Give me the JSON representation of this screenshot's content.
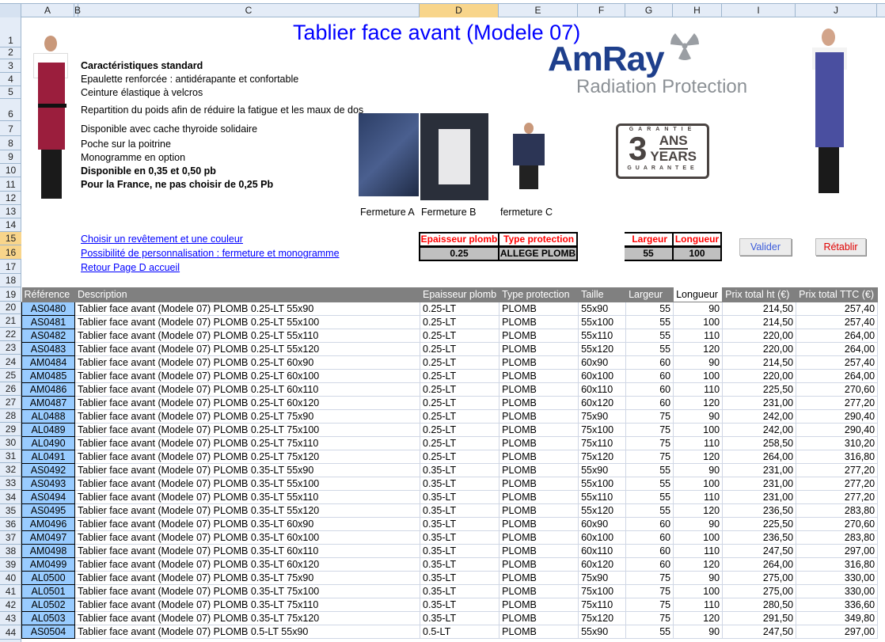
{
  "columns": [
    "A",
    "B",
    "C",
    "D",
    "E",
    "F",
    "G",
    "H",
    "I",
    "J"
  ],
  "title": "Tablier face avant (Modele 07)",
  "features": [
    {
      "text": "Caractéristiques standard",
      "bold": true
    },
    {
      "text": "Epaulette renforcée : antidérapante et confortable",
      "bold": false
    },
    {
      "text": "Ceinture élastique à velcros",
      "bold": false
    },
    {
      "text": "Repartition du poids afin de réduire la fatigue et les maux de dos",
      "bold": false
    },
    {
      "text": "Disponible avec cache thyroide solidaire",
      "bold": false
    },
    {
      "text": "Poche sur la poitrine",
      "bold": false
    },
    {
      "text": "Monogramme en option",
      "bold": false
    },
    {
      "text": "Disponible en 0,35 et 0,50 pb",
      "bold": true
    },
    {
      "text": "Pour la France, ne pas choisir de 0,25 Pb",
      "bold": true
    }
  ],
  "logo": {
    "brand": "AmRay",
    "tagline": "Radiation Protection"
  },
  "badge": {
    "top": "GARANTIE",
    "number": "3",
    "ans": "ANS",
    "years": "YEARS",
    "bottom": "GUARANTEE"
  },
  "captions": [
    "Fermeture A",
    "Fermeture B",
    "fermeture C"
  ],
  "links": [
    "Choisir un revêtement et une couleur",
    "Possibilité de personnalisation : fermeture et monogramme",
    "Retour Page D accueil"
  ],
  "selector": {
    "epaisseur_label": "Epaisseur plomb",
    "type_label": "Type protection",
    "epaisseur": "0.25",
    "type": "ALLEGE PLOMB",
    "largeur_label": "Largeur",
    "longueur_label": "Longueur",
    "largeur": "55",
    "longueur": "100"
  },
  "buttons": {
    "valider": "Valider",
    "retablir": "Rétablir"
  },
  "table": {
    "headers": [
      "Référence",
      "Description",
      "Epaisseur plomb",
      "Type protection",
      "Taille",
      "Largeur",
      "Longueur",
      "Prix total ht (€)",
      "Prix total TTC (€)"
    ],
    "rows": [
      [
        "AS0480",
        "Tablier face avant (Modele 07) PLOMB 0.25-LT 55x90",
        "0.25-LT",
        "PLOMB",
        "55x90",
        "55",
        "90",
        "214,50",
        "257,40"
      ],
      [
        "AS0481",
        "Tablier face avant (Modele 07) PLOMB 0.25-LT 55x100",
        "0.25-LT",
        "PLOMB",
        "55x100",
        "55",
        "100",
        "214,50",
        "257,40"
      ],
      [
        "AS0482",
        "Tablier face avant (Modele 07) PLOMB 0.25-LT 55x110",
        "0.25-LT",
        "PLOMB",
        "55x110",
        "55",
        "110",
        "220,00",
        "264,00"
      ],
      [
        "AS0483",
        "Tablier face avant (Modele 07) PLOMB 0.25-LT 55x120",
        "0.25-LT",
        "PLOMB",
        "55x120",
        "55",
        "120",
        "220,00",
        "264,00"
      ],
      [
        "AM0484",
        "Tablier face avant (Modele 07) PLOMB 0.25-LT 60x90",
        "0.25-LT",
        "PLOMB",
        "60x90",
        "60",
        "90",
        "214,50",
        "257,40"
      ],
      [
        "AM0485",
        "Tablier face avant (Modele 07) PLOMB 0.25-LT 60x100",
        "0.25-LT",
        "PLOMB",
        "60x100",
        "60",
        "100",
        "220,00",
        "264,00"
      ],
      [
        "AM0486",
        "Tablier face avant (Modele 07) PLOMB 0.25-LT 60x110",
        "0.25-LT",
        "PLOMB",
        "60x110",
        "60",
        "110",
        "225,50",
        "270,60"
      ],
      [
        "AM0487",
        "Tablier face avant (Modele 07) PLOMB 0.25-LT 60x120",
        "0.25-LT",
        "PLOMB",
        "60x120",
        "60",
        "120",
        "231,00",
        "277,20"
      ],
      [
        "AL0488",
        "Tablier face avant (Modele 07) PLOMB 0.25-LT 75x90",
        "0.25-LT",
        "PLOMB",
        "75x90",
        "75",
        "90",
        "242,00",
        "290,40"
      ],
      [
        "AL0489",
        "Tablier face avant (Modele 07) PLOMB 0.25-LT 75x100",
        "0.25-LT",
        "PLOMB",
        "75x100",
        "75",
        "100",
        "242,00",
        "290,40"
      ],
      [
        "AL0490",
        "Tablier face avant (Modele 07) PLOMB 0.25-LT 75x110",
        "0.25-LT",
        "PLOMB",
        "75x110",
        "75",
        "110",
        "258,50",
        "310,20"
      ],
      [
        "AL0491",
        "Tablier face avant (Modele 07) PLOMB 0.25-LT 75x120",
        "0.25-LT",
        "PLOMB",
        "75x120",
        "75",
        "120",
        "264,00",
        "316,80"
      ],
      [
        "AS0492",
        "Tablier face avant (Modele 07) PLOMB 0.35-LT 55x90",
        "0.35-LT",
        "PLOMB",
        "55x90",
        "55",
        "90",
        "231,00",
        "277,20"
      ],
      [
        "AS0493",
        "Tablier face avant (Modele 07) PLOMB 0.35-LT 55x100",
        "0.35-LT",
        "PLOMB",
        "55x100",
        "55",
        "100",
        "231,00",
        "277,20"
      ],
      [
        "AS0494",
        "Tablier face avant (Modele 07) PLOMB 0.35-LT 55x110",
        "0.35-LT",
        "PLOMB",
        "55x110",
        "55",
        "110",
        "231,00",
        "277,20"
      ],
      [
        "AS0495",
        "Tablier face avant (Modele 07) PLOMB 0.35-LT 55x120",
        "0.35-LT",
        "PLOMB",
        "55x120",
        "55",
        "120",
        "236,50",
        "283,80"
      ],
      [
        "AM0496",
        "Tablier face avant (Modele 07) PLOMB 0.35-LT 60x90",
        "0.35-LT",
        "PLOMB",
        "60x90",
        "60",
        "90",
        "225,50",
        "270,60"
      ],
      [
        "AM0497",
        "Tablier face avant (Modele 07) PLOMB 0.35-LT 60x100",
        "0.35-LT",
        "PLOMB",
        "60x100",
        "60",
        "100",
        "236,50",
        "283,80"
      ],
      [
        "AM0498",
        "Tablier face avant (Modele 07) PLOMB 0.35-LT 60x110",
        "0.35-LT",
        "PLOMB",
        "60x110",
        "60",
        "110",
        "247,50",
        "297,00"
      ],
      [
        "AM0499",
        "Tablier face avant (Modele 07) PLOMB 0.35-LT 60x120",
        "0.35-LT",
        "PLOMB",
        "60x120",
        "60",
        "120",
        "264,00",
        "316,80"
      ],
      [
        "AL0500",
        "Tablier face avant (Modele 07) PLOMB 0.35-LT 75x90",
        "0.35-LT",
        "PLOMB",
        "75x90",
        "75",
        "90",
        "275,00",
        "330,00"
      ],
      [
        "AL0501",
        "Tablier face avant (Modele 07) PLOMB 0.35-LT 75x100",
        "0.35-LT",
        "PLOMB",
        "75x100",
        "75",
        "100",
        "275,00",
        "330,00"
      ],
      [
        "AL0502",
        "Tablier face avant (Modele 07) PLOMB 0.35-LT 75x110",
        "0.35-LT",
        "PLOMB",
        "75x110",
        "75",
        "110",
        "280,50",
        "336,60"
      ],
      [
        "AL0503",
        "Tablier face avant (Modele 07) PLOMB 0.35-LT 75x120",
        "0.35-LT",
        "PLOMB",
        "75x120",
        "75",
        "120",
        "291,50",
        "349,80"
      ],
      [
        "AS0504",
        "Tablier face avant (Modele 07) PLOMB 0.5-LT 55x90",
        "0.5-LT",
        "PLOMB",
        "55x90",
        "55",
        "90",
        "247,50",
        "297,00"
      ]
    ]
  }
}
